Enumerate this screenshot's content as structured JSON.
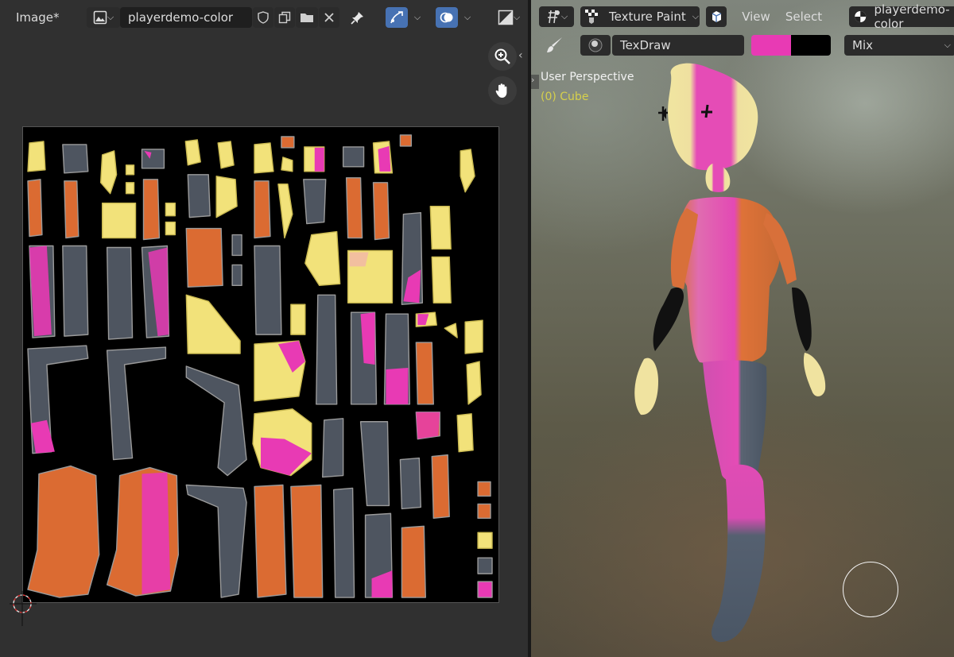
{
  "image_editor": {
    "mode_label": "Image*",
    "image_name": "playerdemo-color"
  },
  "viewport": {
    "mode_label": "Texture Paint",
    "menu_view": "View",
    "menu_select": "Select",
    "image_name": "playerdemo-color",
    "brush_name": "TexDraw",
    "blend_mode": "Mix",
    "overlay_perspective": "User Perspective",
    "overlay_object": "(0) Cube",
    "colors": {
      "primary": "#e83ab4",
      "secondary": "#000000",
      "object_label": "#d6d04c"
    }
  },
  "palette": {
    "yellow": "#f2e27a",
    "orange": "#db6b32",
    "gray": "#4e5560",
    "pink": "#e83ab4",
    "blue_button": "#4772b3"
  }
}
